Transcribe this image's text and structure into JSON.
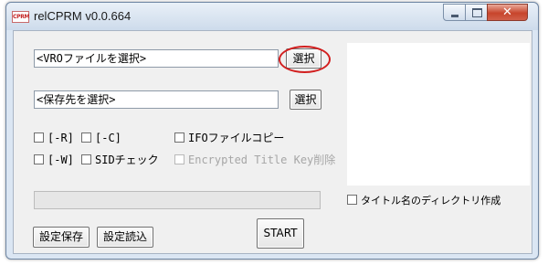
{
  "window": {
    "title": "relCPRM v0.0.664",
    "app_icon_text": "CPRM",
    "min_label": "Minimize",
    "max_label": "Maximize",
    "close_glyph": "✕"
  },
  "form": {
    "vro_input": "<VROファイルを選択>",
    "vro_select_button": "選択",
    "dest_input": "<保存先を選択>",
    "dest_select_button": "選択",
    "progress": 0
  },
  "options": {
    "r": {
      "label": "[-R]",
      "checked": false
    },
    "c": {
      "label": "[-C]",
      "checked": false
    },
    "ifo_copy": {
      "label": "IFOファイルコピー",
      "checked": false
    },
    "w": {
      "label": "[-W]",
      "checked": false
    },
    "sid_check": {
      "label": "SIDチェック",
      "checked": false
    },
    "encrypted_key": {
      "label": "Encrypted Title Key削除",
      "checked": false,
      "disabled": true
    },
    "title_dir": {
      "label": "タイトル名のディレクトリ作成",
      "checked": false
    }
  },
  "buttons": {
    "save_settings": "設定保存",
    "load_settings": "設定読込",
    "start": "START"
  },
  "icons": {
    "app": "cprm-logo-icon",
    "minimize": "minimize-icon",
    "maximize": "maximize-icon",
    "close": "close-icon"
  },
  "colors": {
    "highlight": "#d21f1f",
    "close_button": "#c7452c"
  }
}
